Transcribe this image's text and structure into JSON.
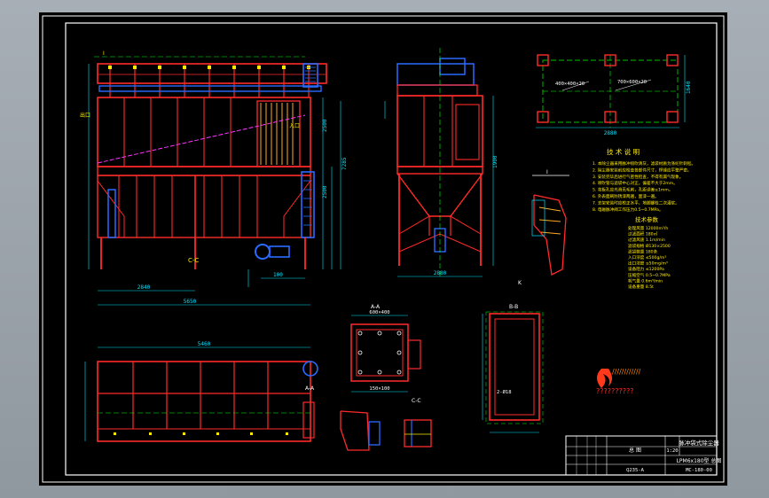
{
  "drawing": {
    "notes_title": "技 术 说 明",
    "notes_lines": [
      "1. 本除尘器采用脉冲喷吹清灰，滤袋材质为涤纶针刺毡。",
      "2. 除尘器安装前应检查各部件尺寸，焊缝应平整严密。",
      "3. 安装完毕后进行气密性检查，不得有漏气现象。",
      "4. 喷吹管与滤袋中心对正，偏差不大于2mm。",
      "5. 花板孔应光滑无毛刺，孔距误差≤1mm。",
      "6. 外表面刷防锈漆两遍，面漆一遍。",
      "7. 支架安装时应校正水平，地脚螺栓二次灌浆。",
      "8. 电磁脉冲阀工作压力0.5~0.7MPa。"
    ],
    "params_title": "技术参数",
    "params": [
      "处理风量  12000m³/h",
      "过滤面积  180㎡",
      "过滤风速  1.1m/min",
      "滤袋规格  Ø130×2500",
      "滤袋数量  180条",
      "入口浓度  ≤500g/m³",
      "出口浓度  ≤50mg/m³",
      "设备阻力  ≤1200Pa",
      "压缩空气  0.5~0.7MPa",
      "耗气量    0.6m³/min",
      "设备重量  8.5t"
    ],
    "logo_caption": "??????????",
    "logo_banner": "////////////",
    "title_block": {
      "company": "脉冲袋式除尘器",
      "drawing_name": "总 图",
      "material": "Q235-A",
      "scale": "1:20",
      "drawing_no": "MC-180-00",
      "subtitle": "LPM6x180型 总图"
    },
    "labels": {
      "inlet": "入口",
      "outlet": "出口",
      "section_aa": "A-A",
      "section_bb": "B-B",
      "section_cc": "C-C",
      "view_i": "I",
      "view_k": "K"
    },
    "dims": {
      "front_total": "5650",
      "front_base": "2840",
      "top_total": "5460",
      "side_total": "2880",
      "height_total": "7285",
      "col1": "2500",
      "col2": "1900",
      "col3": "2500",
      "anchor_a": "400×400×20",
      "anchor_b": "700×600×20",
      "plan_w": "2880",
      "plan_d": "1640",
      "opening_a": "600×400",
      "opening_b": "150×100",
      "flange_w": "100",
      "pipe": "2-Ø18"
    }
  }
}
